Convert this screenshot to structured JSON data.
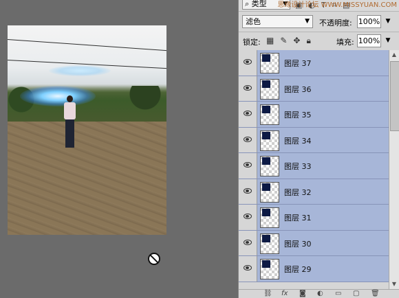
{
  "canvas": {
    "cursor_icon": "not-allowed-icon"
  },
  "layers_panel": {
    "filter": {
      "kind_label": "类型",
      "icons": [
        "image-filter-icon",
        "adjustment-filter-icon",
        "type-filter-icon",
        "shape-filter-icon",
        "smart-object-filter-icon"
      ]
    },
    "watermark": "思缘设计论坛 WWW.MISSYUAN.COM",
    "blend_mode": "滤色",
    "opacity_label": "不透明度:",
    "opacity_value": "100%",
    "lock_label": "锁定:",
    "lock_icons": [
      "lock-transparent-icon",
      "lock-image-icon",
      "lock-position-icon",
      "lock-all-icon"
    ],
    "fill_label": "填充:",
    "fill_value": "100%",
    "layers": [
      {
        "name": "图层 37"
      },
      {
        "name": "图层 36"
      },
      {
        "name": "图层 35"
      },
      {
        "name": "图层 34"
      },
      {
        "name": "图层 33"
      },
      {
        "name": "图层 32"
      },
      {
        "name": "图层 31"
      },
      {
        "name": "图层 30"
      },
      {
        "name": "图层 29"
      }
    ],
    "bottom_icons": [
      "link-icon",
      "fx-icon",
      "mask-icon",
      "adjustment-icon",
      "group-icon",
      "new-layer-icon",
      "trash-icon"
    ],
    "bottom_labels": [
      "fx"
    ]
  }
}
